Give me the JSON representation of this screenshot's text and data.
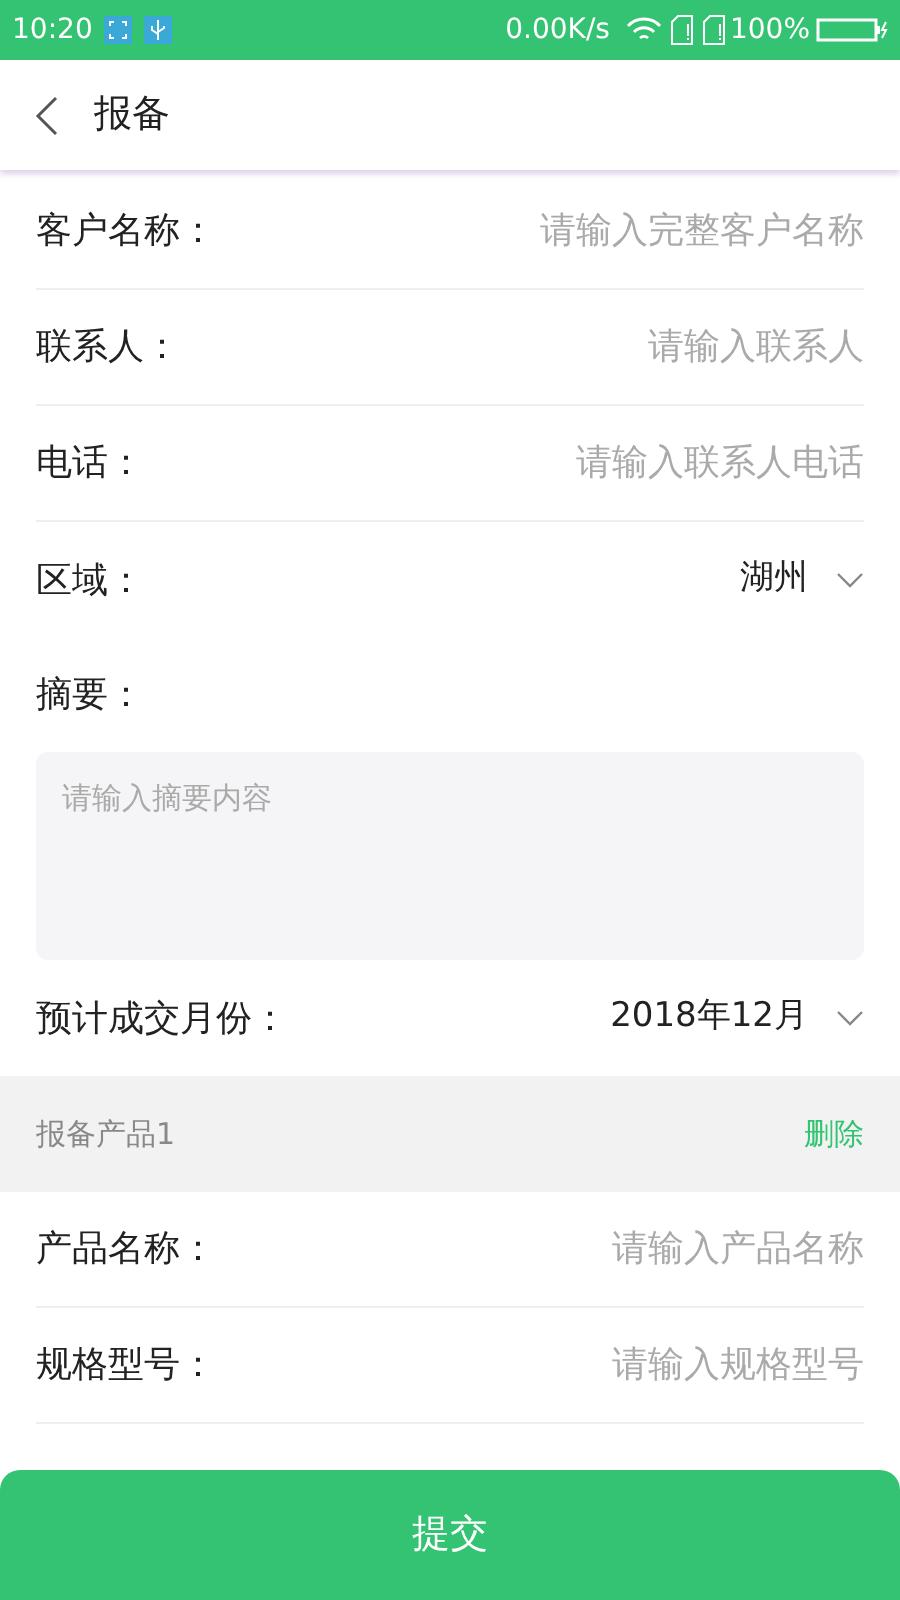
{
  "status_bar": {
    "time": "10:20",
    "speed": "0.00K/s",
    "battery": "100%"
  },
  "header": {
    "title": "报备"
  },
  "fields": [
    {
      "kind": "input",
      "label": "客户名称：",
      "placeholder": "请输入完整客户名称"
    },
    {
      "kind": "input",
      "label": "联系人：",
      "placeholder": "请输入联系人"
    },
    {
      "kind": "input",
      "label": "电话：",
      "placeholder": "请输入联系人电话"
    },
    {
      "kind": "select",
      "label": "区域：",
      "value": "湖州"
    },
    {
      "kind": "textarea",
      "label": "摘要：",
      "placeholder": "请输入摘要内容"
    },
    {
      "kind": "select",
      "label": "预计成交月份：",
      "value": "2018年12月"
    }
  ],
  "product_section": {
    "title": "报备产品1",
    "action": "删除",
    "fields": [
      {
        "kind": "input",
        "label": "产品名称：",
        "placeholder": "请输入产品名称"
      },
      {
        "kind": "input",
        "label": "规格型号：",
        "placeholder": "请输入规格型号"
      }
    ]
  },
  "submit_button": "提交"
}
